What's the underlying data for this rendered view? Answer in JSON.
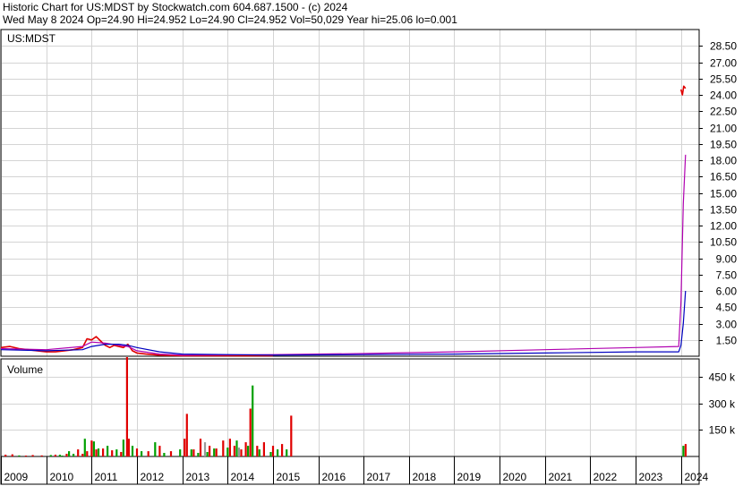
{
  "header": {
    "line1": "Historic Chart for US:MDST by Stockwatch.com 604.687.1500 - (c) 2024",
    "line2": "Wed May  8 2024   Op=24.90   Hi=24.952   Lo=24.90   Cl=24.952   Vol=50,029   Year hi=25.06   lo=0.001"
  },
  "chart_data": [
    {
      "type": "line",
      "title": "US:MDST",
      "ylim": [
        0,
        30
      ],
      "yticks": [
        1.5,
        3.0,
        4.5,
        6.0,
        7.5,
        9.0,
        10.5,
        12.0,
        13.5,
        15.0,
        16.5,
        18.0,
        19.5,
        21.0,
        22.5,
        24.0,
        25.5,
        27.0,
        28.5
      ],
      "ytick_labels": [
        "1.50",
        "3.00",
        "4.50",
        "6.00",
        "7.50",
        "9.00",
        "10.50",
        "12.00",
        "13.50",
        "15.00",
        "16.50",
        "18.00",
        "19.50",
        "21.00",
        "22.50",
        "24.00",
        "25.50",
        "27.00",
        "28.50"
      ],
      "xlim": [
        2009.0,
        2024.4
      ],
      "series": [
        {
          "color": "#e00000",
          "style": "price",
          "x": [
            2009.0,
            2009.2,
            2009.4,
            2009.6,
            2009.8,
            2010.0,
            2010.2,
            2010.4,
            2010.6,
            2010.8,
            2010.9,
            2011.0,
            2011.1,
            2011.2,
            2011.3,
            2011.4,
            2011.5,
            2011.6,
            2011.7,
            2011.8,
            2011.9,
            2012.0,
            2012.2,
            2012.5,
            2013.0,
            2014.0,
            2015.0
          ],
          "y": [
            0.8,
            0.9,
            0.7,
            0.6,
            0.5,
            0.4,
            0.4,
            0.5,
            0.6,
            0.8,
            1.6,
            1.5,
            1.8,
            1.4,
            1.0,
            0.8,
            1.0,
            0.9,
            0.8,
            1.1,
            0.5,
            0.3,
            0.2,
            0.1,
            0.05,
            0.05,
            0.05
          ]
        },
        {
          "color": "#e00000",
          "style": "price",
          "x": [
            2024.0,
            2024.03,
            2024.06,
            2024.1
          ],
          "y": [
            24.5,
            24.0,
            24.8,
            24.6
          ]
        },
        {
          "color": "#b000b0",
          "style": "moving-average",
          "x": [
            2009.0,
            2010.0,
            2010.8,
            2011.0,
            2011.3,
            2011.6,
            2011.8,
            2012.0,
            2012.5,
            2013.0,
            2015.0,
            2017.0,
            2019.0,
            2021.0,
            2023.0,
            2023.95,
            2024.0,
            2024.05,
            2024.1
          ],
          "y": [
            0.7,
            0.6,
            0.9,
            1.3,
            1.2,
            1.0,
            0.9,
            0.5,
            0.2,
            0.1,
            0.15,
            0.25,
            0.4,
            0.6,
            0.8,
            0.9,
            5.0,
            14.0,
            18.5
          ]
        },
        {
          "color": "#0000c0",
          "style": "moving-average",
          "x": [
            2009.0,
            2010.0,
            2010.8,
            2011.0,
            2011.3,
            2011.6,
            2011.8,
            2012.0,
            2012.5,
            2013.0,
            2015.0,
            2017.0,
            2019.0,
            2021.0,
            2023.0,
            2023.95,
            2024.0,
            2024.05,
            2024.1
          ],
          "y": [
            0.6,
            0.5,
            0.6,
            0.9,
            1.1,
            1.1,
            1.0,
            0.8,
            0.4,
            0.2,
            0.1,
            0.15,
            0.2,
            0.3,
            0.4,
            0.4,
            1.0,
            3.0,
            6.0
          ]
        }
      ]
    },
    {
      "type": "bar",
      "title": "Volume",
      "ylim": [
        0,
        550
      ],
      "yticks": [
        150,
        300,
        450
      ],
      "ytick_labels": [
        "150 k",
        "300 k",
        "450 k"
      ],
      "xlim": [
        2009.0,
        2024.4
      ],
      "series": [
        {
          "name": "up",
          "color": "#00a000",
          "x": [
            2009.4,
            2010.1,
            2010.3,
            2010.35,
            2010.5,
            2010.6,
            2010.85,
            2011.05,
            2011.15,
            2011.35,
            2011.55,
            2011.7,
            2011.9,
            2012.1,
            2012.4,
            2012.6,
            2012.95,
            2013.2,
            2013.35,
            2013.55,
            2013.7,
            2014.0,
            2014.2,
            2014.45,
            2014.55,
            2014.7,
            2014.95,
            2015.1,
            2015.3,
            2024.05
          ],
          "values": [
            6,
            8,
            10,
            5,
            30,
            15,
            100,
            85,
            45,
            60,
            40,
            95,
            60,
            30,
            80,
            20,
            40,
            40,
            20,
            25,
            45,
            50,
            90,
            60,
            400,
            40,
            25,
            40,
            40,
            60
          ]
        },
        {
          "name": "down",
          "color": "#e00000",
          "x": [
            2009.1,
            2009.25,
            2009.55,
            2009.7,
            2009.9,
            2010.2,
            2010.45,
            2010.7,
            2010.8,
            2010.9,
            2011.0,
            2011.1,
            2011.25,
            2011.45,
            2011.65,
            2011.78,
            2011.82,
            2012.0,
            2012.25,
            2012.5,
            2012.75,
            2013.05,
            2013.1,
            2013.25,
            2013.4,
            2013.6,
            2013.75,
            2013.9,
            2014.05,
            2014.15,
            2014.3,
            2014.4,
            2014.5,
            2014.65,
            2014.8,
            2015.0,
            2015.2,
            2015.4,
            2024.1
          ],
          "values": [
            10,
            12,
            5,
            8,
            6,
            10,
            15,
            40,
            15,
            30,
            90,
            40,
            45,
            35,
            25,
            560,
            100,
            45,
            30,
            60,
            30,
            100,
            240,
            40,
            100,
            60,
            45,
            90,
            100,
            60,
            40,
            80,
            270,
            60,
            80,
            60,
            70,
            230,
            70
          ]
        },
        {
          "name": "unchanged",
          "color": "#9a9a9a",
          "x": [
            2013.5,
            2014.25
          ],
          "values": [
            80,
            50
          ]
        }
      ]
    }
  ],
  "x_axis": {
    "labels": [
      "2009",
      "2010",
      "2011",
      "2012",
      "2013",
      "2014",
      "2015",
      "2016",
      "2017",
      "2018",
      "2019",
      "2020",
      "2021",
      "2022",
      "2023",
      "2024"
    ],
    "years": [
      2009,
      2010,
      2011,
      2012,
      2013,
      2014,
      2015,
      2016,
      2017,
      2018,
      2019,
      2020,
      2021,
      2022,
      2023,
      2024
    ]
  }
}
